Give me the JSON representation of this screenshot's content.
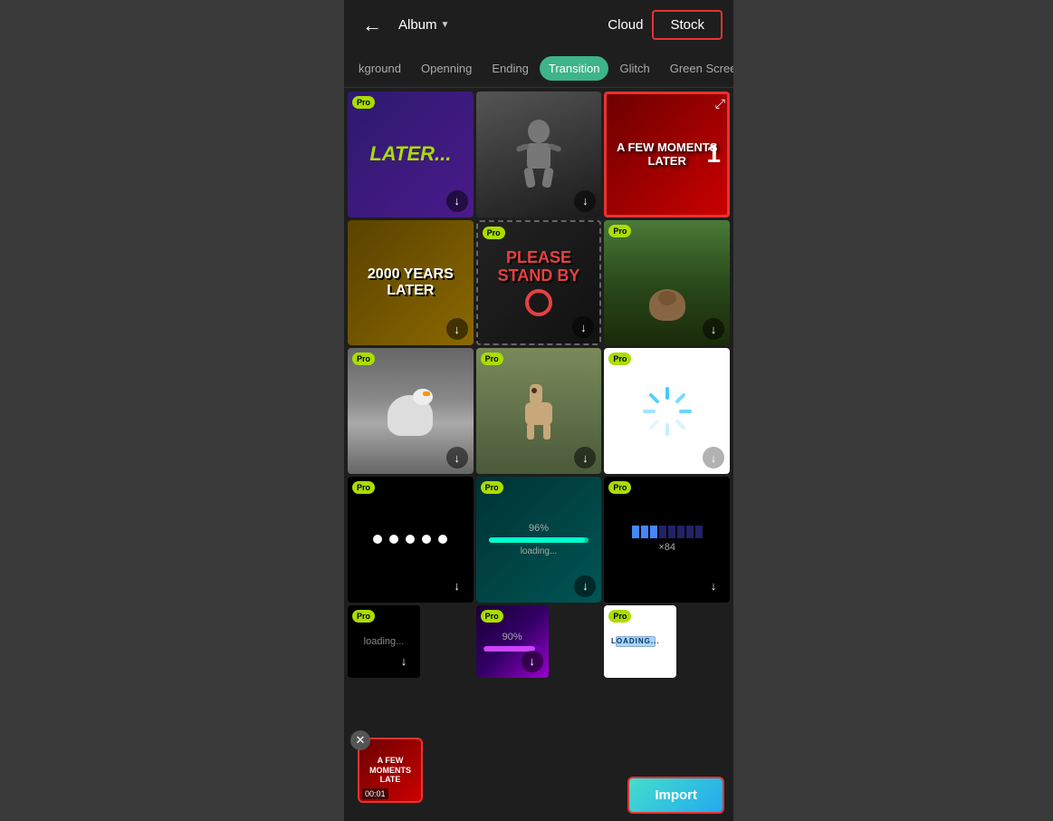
{
  "header": {
    "back_label": "←",
    "album_label": "Album",
    "album_arrow": "▼",
    "cloud_label": "Cloud",
    "stock_label": "Stock"
  },
  "tabs": [
    {
      "id": "background",
      "label": "kground"
    },
    {
      "id": "opening",
      "label": "Openning"
    },
    {
      "id": "ending",
      "label": "Ending"
    },
    {
      "id": "transition",
      "label": "Transition",
      "active": true
    },
    {
      "id": "glitch",
      "label": "Glitch"
    },
    {
      "id": "greenscreen",
      "label": "Green Screen"
    }
  ],
  "grid": {
    "items": [
      {
        "id": "item1",
        "bg": "bg-purple-later",
        "pro": true,
        "text": "LATER...",
        "text_class": "later-text",
        "has_download": true,
        "selected": false
      },
      {
        "id": "item2",
        "bg": "bg-dark-person",
        "pro": false,
        "text": "",
        "has_download": true,
        "selected": false
      },
      {
        "id": "item3",
        "bg": "bg-red-moments",
        "pro": false,
        "text": "A FEW MOMENTS LATER",
        "text_class": "moments-text",
        "has_expand": true,
        "number": "1",
        "selected": true
      },
      {
        "id": "item4",
        "bg": "bg-2000years",
        "pro": false,
        "text": "2000 YEARS LATER",
        "text_class": "years-text",
        "has_download": true,
        "selected": false
      },
      {
        "id": "item5",
        "bg": "bg-standby",
        "pro": true,
        "type": "standby",
        "has_download": true,
        "selected": false
      },
      {
        "id": "item6",
        "bg": "bg-nature",
        "pro": true,
        "type": "nature",
        "has_download": true,
        "selected": false
      },
      {
        "id": "item7",
        "bg": "bg-duck",
        "pro": true,
        "type": "duck",
        "has_download": true,
        "selected": false
      },
      {
        "id": "item8",
        "bg": "bg-llama",
        "pro": true,
        "type": "llama",
        "has_download": true,
        "selected": false
      },
      {
        "id": "item9",
        "bg": "bg-spinner",
        "pro": true,
        "type": "spinner",
        "has_download": true,
        "selected": false
      },
      {
        "id": "item10",
        "bg": "bg-dots",
        "pro": true,
        "type": "dots",
        "has_download": true,
        "selected": false
      },
      {
        "id": "item11",
        "bg": "bg-loading-teal",
        "pro": true,
        "type": "loading-teal",
        "has_download": true,
        "selected": false
      },
      {
        "id": "item12",
        "bg": "bg-loading-bar",
        "pro": true,
        "type": "loading-bar",
        "has_download": true,
        "selected": false
      },
      {
        "id": "item13",
        "bg": "bg-loading2",
        "pro": true,
        "type": "loading2",
        "has_download": true,
        "selected": false
      },
      {
        "id": "item14",
        "bg": "bg-loading-purple",
        "pro": true,
        "type": "loading-purple",
        "has_download": true,
        "selected": false
      },
      {
        "id": "item15",
        "bg": "bg-loading3",
        "pro": true,
        "type": "loading3",
        "has_download": false,
        "selected": false
      }
    ]
  },
  "import_btn": "Import",
  "preview": {
    "text": "A FEW MOMENTS LATE",
    "time": "00:01"
  },
  "pro_label": "Pro",
  "download_icon": "↓",
  "expand_icon": "⤢",
  "close_icon": "✕"
}
